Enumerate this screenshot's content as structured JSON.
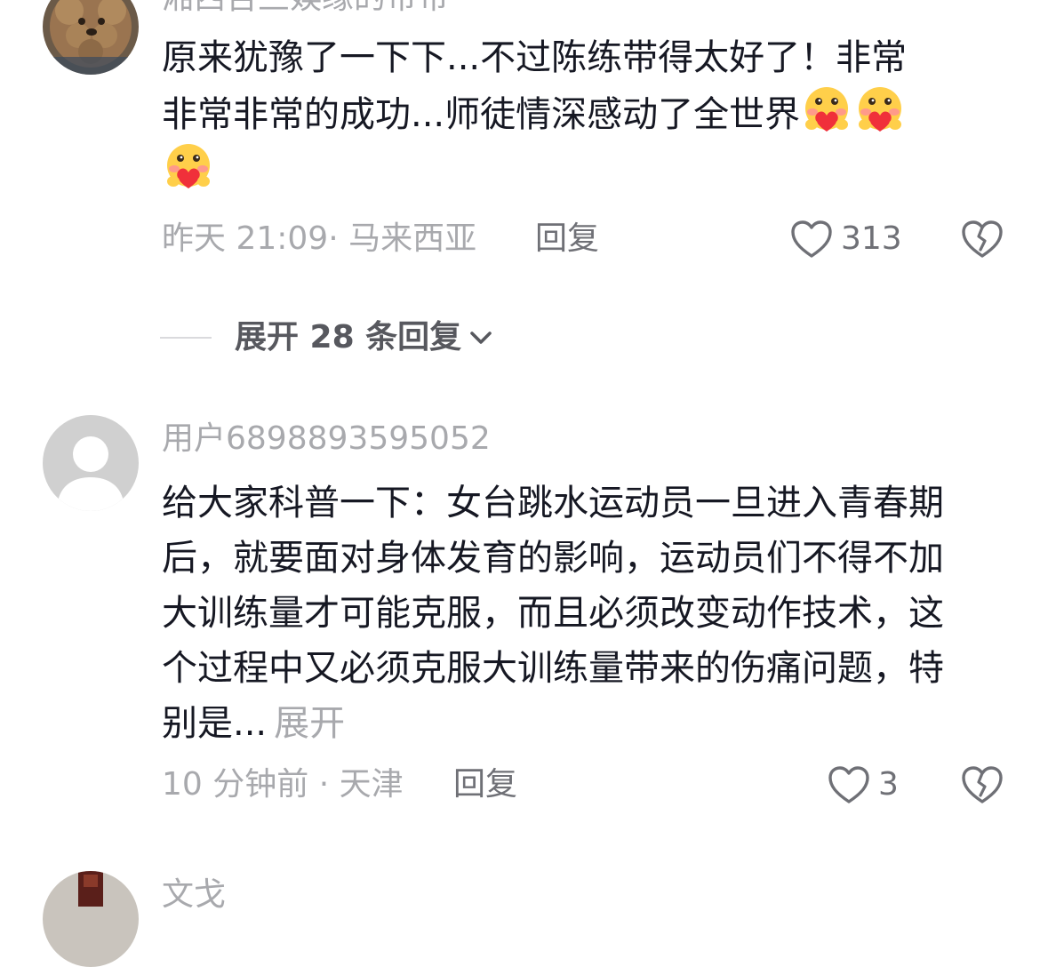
{
  "comments": [
    {
      "username": "湘西吉兰娱缘的带带",
      "text_line1": "原来犹豫了一下下...不过陈练带得太好了！非常",
      "text_line2": "非常非常的成功...师徒情深感动了全世界",
      "emoji_name": "heart-hug-emoji",
      "time_location": "昨天 21:09· 马来西亚",
      "reply_label": "回复",
      "like_count": "313",
      "expand_replies_label": "展开 28 条回复"
    },
    {
      "username": "用户6898893595052",
      "text": "给大家科普一下：女台跳水运动员一旦进入青春期后，就要面对身体发育的影响，运动员们不得不加大训练量才可能克服，而且必须改变动作技术，这个过程中又必须克服大训练量带来的伤痛问题，特别是...",
      "more_label": "展开",
      "time_location": "10 分钟前 · 天津",
      "reply_label": "回复",
      "like_count": "3"
    },
    {
      "username": "文戈"
    }
  ],
  "colors": {
    "text_primary": "#161823",
    "text_secondary": "#a8a9ad",
    "action_gray": "#6f7076"
  },
  "icons": {
    "like": "heart-outline-icon",
    "dislike": "broken-heart-icon",
    "expand": "chevron-down-icon"
  }
}
